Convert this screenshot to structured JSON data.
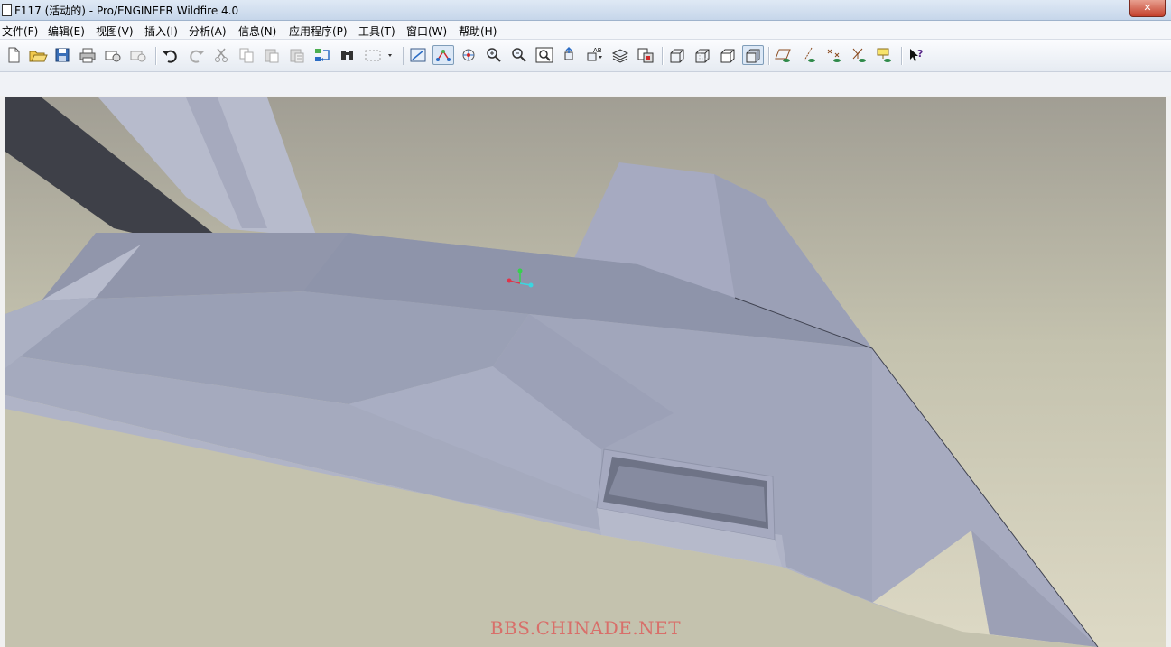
{
  "window": {
    "title": "F117 (活动的) - Pro/ENGINEER Wildfire 4.0",
    "close_label": "✕"
  },
  "menubar": {
    "items": [
      {
        "label": "文件(F)"
      },
      {
        "label": "编辑(E)"
      },
      {
        "label": "视图(V)"
      },
      {
        "label": "插入(I)"
      },
      {
        "label": "分析(A)"
      },
      {
        "label": "信息(N)"
      },
      {
        "label": "应用程序(P)"
      },
      {
        "label": "工具(T)"
      },
      {
        "label": "窗口(W)"
      },
      {
        "label": "帮助(H)"
      }
    ]
  },
  "toolbar": {
    "buttons": [
      {
        "icon": "new-file-icon"
      },
      {
        "icon": "open-folder-icon"
      },
      {
        "icon": "save-icon"
      },
      {
        "icon": "print-icon"
      },
      {
        "icon": "send-mail-icon"
      },
      {
        "icon": "send-attachment-icon"
      },
      {
        "icon": "undo-icon"
      },
      {
        "icon": "redo-icon"
      },
      {
        "icon": "cut-icon"
      },
      {
        "icon": "copy-icon"
      },
      {
        "icon": "paste-icon"
      },
      {
        "icon": "paste-special-icon"
      },
      {
        "icon": "regenerate-icon"
      },
      {
        "icon": "find-icon"
      },
      {
        "icon": "select-box-icon"
      },
      {
        "icon": "redraw-icon"
      },
      {
        "icon": "spin-center-icon"
      },
      {
        "icon": "orient-mode-icon"
      },
      {
        "icon": "zoom-in-icon"
      },
      {
        "icon": "zoom-out-icon"
      },
      {
        "icon": "refit-icon"
      },
      {
        "icon": "reorient-icon"
      },
      {
        "icon": "saved-views-icon"
      },
      {
        "icon": "layers-icon"
      },
      {
        "icon": "view-manager-icon"
      },
      {
        "icon": "wireframe-icon"
      },
      {
        "icon": "hidden-line-icon"
      },
      {
        "icon": "no-hidden-icon"
      },
      {
        "icon": "shading-icon"
      },
      {
        "icon": "datum-planes-icon"
      },
      {
        "icon": "datum-axes-icon"
      },
      {
        "icon": "datum-points-icon"
      },
      {
        "icon": "coordinate-systems-icon"
      },
      {
        "icon": "annotations-icon"
      },
      {
        "icon": "context-help-icon"
      }
    ]
  },
  "viewport": {
    "watermark": "BBS.CHINADE.NET",
    "colors": {
      "bg_top": "#a19e94",
      "bg_bottom": "#ddd9c5",
      "model_base": "#9ea3b8",
      "model_dark": "#3e4048",
      "watermark": "#d86f6a"
    },
    "triad": {
      "x_color": "#e0344a",
      "y_color": "#36d14d",
      "z_color": "#3ad6e0"
    }
  }
}
